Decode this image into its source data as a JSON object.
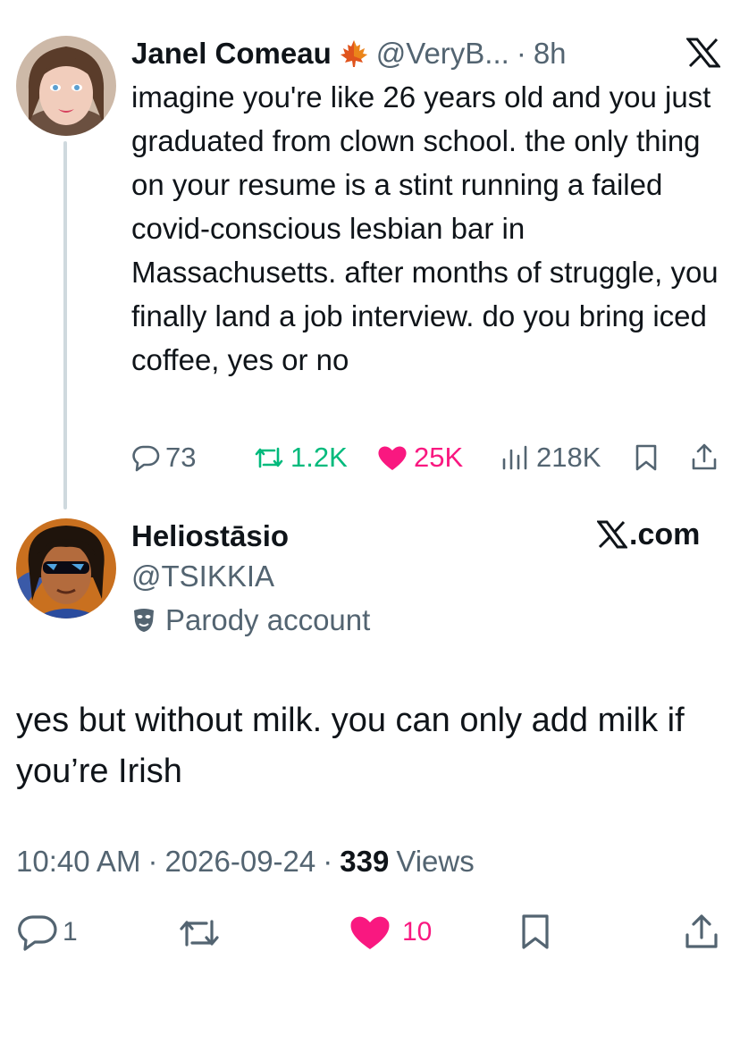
{
  "quoted": {
    "author_name": "Janel Comeau",
    "author_handle": "@VeryB...",
    "separator": "·",
    "time": "8h",
    "text": "imagine you're like 26 years old and you just graduated from clown school. the only thing on your resume is a stint running a failed covid-conscious lesbian bar in Massachusetts. after months of struggle, you finally land a job interview. do you bring iced coffee, yes or no",
    "stats": {
      "replies": "73",
      "reposts": "1.2K",
      "likes": "25K",
      "views": "218K"
    },
    "icons": [
      "reply-icon",
      "repost-icon",
      "heart-icon",
      "views-icon",
      "bookmark-icon",
      "share-icon",
      "x-logo-icon",
      "maple-leaf-icon"
    ]
  },
  "reply": {
    "author_name": "Heliostāsio",
    "author_handle": "@TSIKKIA",
    "parody_label": "Parody account",
    "xcom": ".com",
    "text": "yes but without milk. you can only add milk if you’re Irish",
    "time": "10:40 AM",
    "dot": "·",
    "date": "2026-09-24",
    "views_count": "339",
    "views_label": "Views",
    "stats": {
      "replies": "1",
      "likes": "10"
    }
  },
  "colors": {
    "text": "#0f1419",
    "secondary": "#536471",
    "repost": "#00ba7c",
    "like": "#f91880",
    "line": "#cfd9de"
  }
}
